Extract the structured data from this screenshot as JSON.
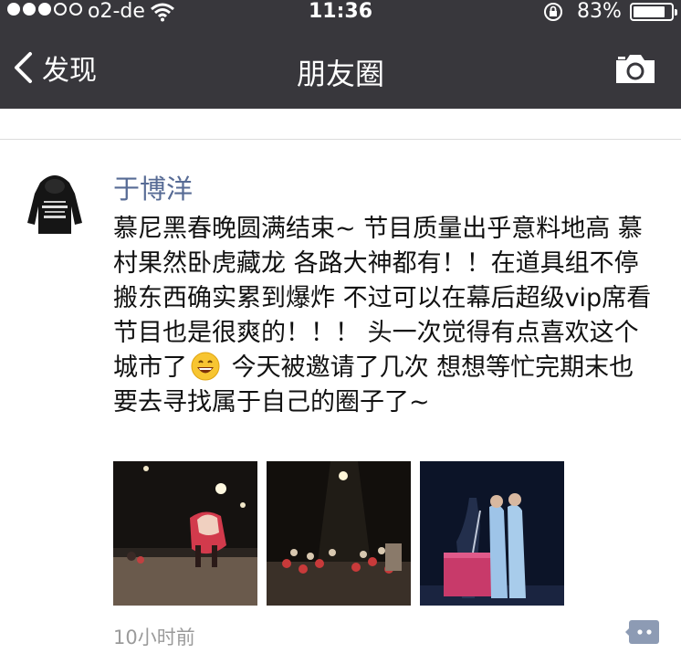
{
  "status_bar": {
    "carrier": "o2-de",
    "time": "11:36",
    "battery": "83%",
    "battery_level": 0.83,
    "signal_bars_filled": 3,
    "signal_bars_total": 5
  },
  "nav": {
    "back_label": "发现",
    "title": "朋友圈",
    "camera_icon": "camera-icon",
    "back_icon": "chevron-left-icon"
  },
  "post": {
    "author": "于博洋",
    "avatar_icon": "hoodie-avatar",
    "text_before_emoji": "慕尼黑春晚圆满结束~ 节目质量出乎意料地高 慕村果然卧虎藏龙 各路大神都有！！在道具组不停搬东西确实累到爆炸 不过可以在幕后超级vip席看节目也是很爽的！！！ 头一次觉得有点喜欢这个城市了",
    "emoji_icon": "grinning-face-emoji",
    "text_after_emoji": " 今天被邀请了几次 想想等忙完期末也要去寻找属于自己的圈子了~",
    "photos": [
      {
        "icon": "lion-dance-photo"
      },
      {
        "icon": "orchestra-photo"
      },
      {
        "icon": "crosstalk-performers-photo"
      }
    ],
    "timestamp": "10小时前",
    "comment_icon": "comment-bubble-icon"
  },
  "colors": {
    "header_bg": "#38373c",
    "author_link": "#576b95",
    "timestamp": "#9b9b9b"
  }
}
